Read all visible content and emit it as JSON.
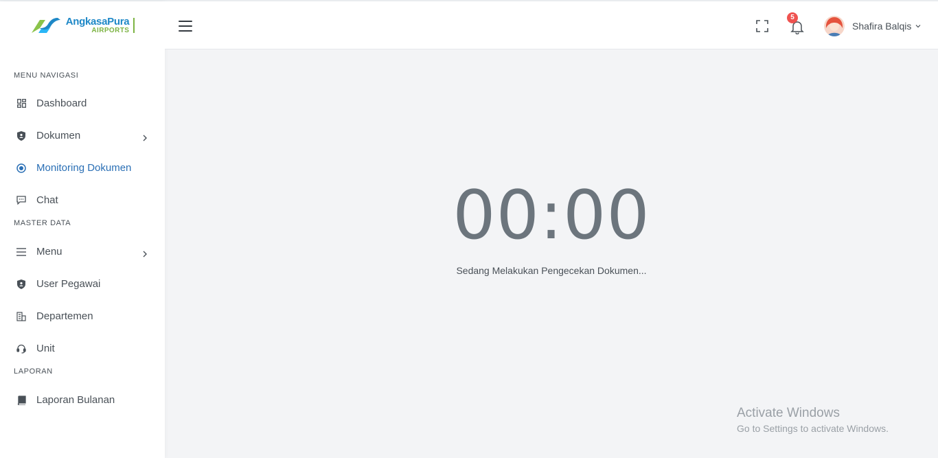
{
  "brand": {
    "name": "AngkasaPura",
    "sub": "AIRPORTS"
  },
  "sidebar": {
    "sections": [
      {
        "title": "MENU NAVIGASI"
      },
      {
        "title": "MASTER DATA"
      },
      {
        "title": "LAPORAN"
      }
    ],
    "items": [
      {
        "label": "Dashboard",
        "icon": "dashboard-icon"
      },
      {
        "label": "Dokumen",
        "icon": "shield-icon",
        "has_submenu": true
      },
      {
        "label": "Monitoring Dokumen",
        "icon": "record-icon",
        "active": true
      },
      {
        "label": "Chat",
        "icon": "chat-icon"
      },
      {
        "label": "Menu",
        "icon": "list-icon",
        "has_submenu": true
      },
      {
        "label": "User Pegawai",
        "icon": "shield-user-icon"
      },
      {
        "label": "Departemen",
        "icon": "building-icon"
      },
      {
        "label": "Unit",
        "icon": "headset-icon"
      },
      {
        "label": "Laporan Bulanan",
        "icon": "book-icon"
      }
    ]
  },
  "header": {
    "notification_count": "5",
    "user_name": "Shafira Balqis"
  },
  "main": {
    "timer": "00:00",
    "status": "Sedang Melakukan Pengecekan Dokumen..."
  },
  "watermark": {
    "title": "Activate Windows",
    "subtitle": "Go to Settings to activate Windows."
  },
  "colors": {
    "accent": "#2a6fb5",
    "badge": "#ef5350",
    "background": "#f3f4f6"
  }
}
